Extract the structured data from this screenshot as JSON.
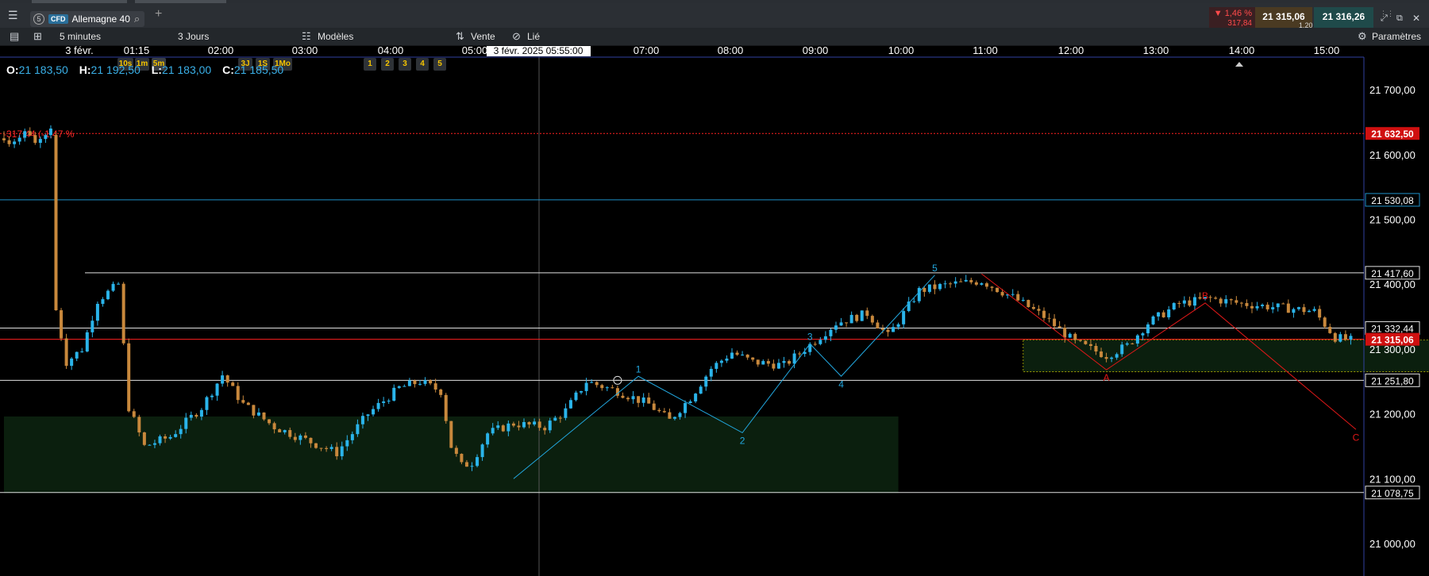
{
  "toolbar": {
    "instrument_type": "CFD",
    "instrument": "Allemagne 40",
    "add_tab": "+",
    "change_pct": "▼ 1,46 %",
    "change_abs": "317,84",
    "bid": "21 315,06",
    "ask": "21 316,26",
    "spread": "1,20"
  },
  "toolbar2": {
    "interval": "5 minutes",
    "intervals": [
      "10s",
      "1m",
      "5m"
    ],
    "period": "3 Jours",
    "periods": [
      "3J",
      "1S",
      "1Mo"
    ],
    "models": "Modèles",
    "counts": [
      "1",
      "2",
      "3",
      "4",
      "5"
    ],
    "sell": "Vente",
    "linked": "Lié",
    "settings": "Paramètres"
  },
  "hud": {
    "o_label": "O:",
    "o": "21 183,50",
    "h_label": "H:",
    "h": "21 192,50",
    "l_label": "L:",
    "l": "21 183,00",
    "c_label": "C:",
    "c": "21 185,50"
  },
  "chart_data": {
    "type": "candlestick",
    "date_label": "3 févr.",
    "crosshair_time": "3 févr. 2025 05:55:00",
    "x_ticks": [
      "01:15",
      "02:00",
      "03:00",
      "04:00",
      "05:00",
      "07:00",
      "08:00",
      "09:00",
      "10:00",
      "11:00",
      "12:00",
      "13:00",
      "14:00",
      "15:00"
    ],
    "y_ticks": [
      "21 700,00",
      "21 600,00",
      "21 500,00",
      "21 400,00",
      "21 300,00",
      "21 200,00",
      "21 100,00",
      "21 000,00"
    ],
    "ylim": [
      20950,
      21760
    ],
    "prev_close_label": "-317,44 (-1,47 %",
    "levels": [
      {
        "value": 21632.5,
        "label": "21 632,50",
        "color": "#ff2020",
        "style": "dotted"
      },
      {
        "value": 21530.08,
        "label": "21 530,08",
        "color": "#1e90c8",
        "style": "solid"
      },
      {
        "value": 21417.6,
        "label": "21 417,60",
        "color": "#e0e0e0",
        "style": "solid"
      },
      {
        "value": 21332.44,
        "label": "21 332,44",
        "color": "#e0e0e0",
        "style": "solid"
      },
      {
        "value": 21315.06,
        "label": "21 315,06",
        "color": "#ff2020",
        "style": "solid",
        "current": true
      },
      {
        "value": 21251.8,
        "label": "21 251,80",
        "color": "#e0e0e0",
        "style": "solid"
      },
      {
        "value": 21078.75,
        "label": "21 078,75",
        "color": "#e0e0e0",
        "style": "solid"
      }
    ],
    "zones": [
      {
        "t0": 0,
        "t1": 172,
        "y0": 21078,
        "y1": 21196,
        "color": "#0b1f0e"
      },
      {
        "t0": 196,
        "t1": 300,
        "y0": 21265,
        "y1": 21314,
        "color": "#0b1f0e"
      }
    ],
    "wave_impulse": {
      "color": "#22a8e0",
      "points": [
        [
          98,
          21100
        ],
        [
          122,
          21258
        ],
        [
          142,
          21171
        ],
        [
          155,
          21308
        ],
        [
          161,
          21258
        ],
        [
          179,
          21414
        ]
      ],
      "labels": [
        "1",
        "2",
        "3",
        "4",
        "5"
      ]
    },
    "wave_correction": {
      "color": "#e01818",
      "points": [
        [
          188,
          21416
        ],
        [
          212,
          21268
        ],
        [
          231,
          21371
        ],
        [
          260,
          21176
        ]
      ],
      "labels": [
        "A",
        "B",
        "C"
      ]
    },
    "candles": [
      [
        21625,
        21636,
        21618,
        21622
      ],
      [
        21622,
        21628,
        21612,
        21616
      ],
      [
        21616,
        21624,
        21610,
        21620
      ],
      [
        21620,
        21630,
        21615,
        21626
      ],
      [
        21626,
        21640,
        21620,
        21636
      ],
      [
        21636,
        21642,
        21628,
        21630
      ],
      [
        21630,
        21635,
        21615,
        21618
      ],
      [
        21618,
        21628,
        21610,
        21624
      ],
      [
        21624,
        21632,
        21618,
        21630
      ],
      [
        21630,
        21645,
        21625,
        21640
      ]
    ]
  },
  "colors": {
    "up": "#2ab4ea",
    "down": "#c8883c",
    "bg": "#000000"
  }
}
